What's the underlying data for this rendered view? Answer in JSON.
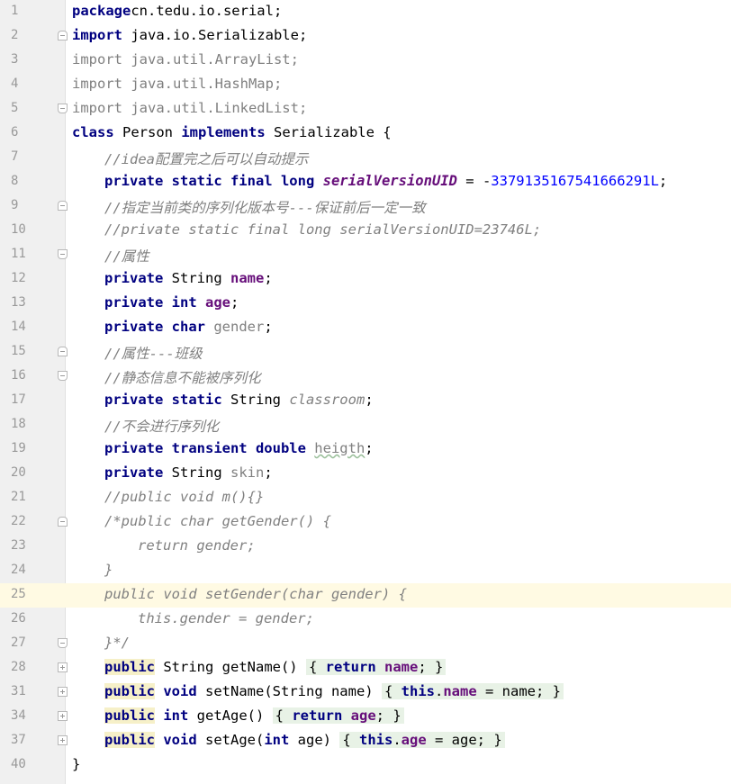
{
  "editor": {
    "current_line": "25",
    "lines": [
      {
        "n": "1",
        "fold": "",
        "indent": 0,
        "tokens": [
          [
            "kw",
            "package"
          ],
          [
            "",
            "cn.tedu.io.serial;"
          ]
        ]
      },
      {
        "n": "2",
        "fold": "start",
        "indent": 0,
        "tokens": [
          [
            "kw",
            "import"
          ],
          [
            "",
            " java.io.Serializable;"
          ]
        ]
      },
      {
        "n": "3",
        "fold": "",
        "indent": 0,
        "tokens": [
          [
            "kwg",
            "import"
          ],
          [
            "gray",
            " java.util.ArrayList;"
          ]
        ]
      },
      {
        "n": "4",
        "fold": "",
        "indent": 0,
        "tokens": [
          [
            "kwg",
            "import"
          ],
          [
            "gray",
            " java.util.HashMap;"
          ]
        ]
      },
      {
        "n": "5",
        "fold": "end",
        "indent": 0,
        "tokens": [
          [
            "kwg",
            "import"
          ],
          [
            "gray",
            " java.util.LinkedList;"
          ]
        ]
      },
      {
        "n": "6",
        "fold": "",
        "indent": 0,
        "tokens": [
          [
            "kw",
            "class"
          ],
          [
            "",
            " Person "
          ],
          [
            "kw",
            "implements"
          ],
          [
            "",
            " Serializable {"
          ]
        ]
      },
      {
        "n": "7",
        "fold": "",
        "indent": 1,
        "tokens": [
          [
            "cmt",
            "//idea配置完之后可以自动提示"
          ]
        ]
      },
      {
        "n": "8",
        "fold": "",
        "indent": 1,
        "tokens": [
          [
            "kw",
            "private static final long "
          ],
          [
            "const",
            "serialVersionUID"
          ],
          [
            "",
            " = -"
          ],
          [
            "num",
            "3379135167541666291L"
          ],
          [
            "",
            ";"
          ]
        ]
      },
      {
        "n": "9",
        "fold": "start",
        "indent": 1,
        "tokens": [
          [
            "cmt",
            "//指定当前类的序列化版本号---保证前后一定一致"
          ]
        ]
      },
      {
        "n": "10",
        "fold": "",
        "indent": 1,
        "tokens": [
          [
            "cmt",
            "//private static final long serialVersionUID=23746L;"
          ]
        ]
      },
      {
        "n": "11",
        "fold": "end",
        "indent": 1,
        "tokens": [
          [
            "cmt",
            "//属性"
          ]
        ]
      },
      {
        "n": "12",
        "fold": "",
        "indent": 1,
        "tokens": [
          [
            "kw",
            "private"
          ],
          [
            "",
            " String "
          ],
          [
            "fld",
            "name"
          ],
          [
            "",
            ";"
          ]
        ]
      },
      {
        "n": "13",
        "fold": "",
        "indent": 1,
        "tokens": [
          [
            "kw",
            "private int "
          ],
          [
            "fld",
            "age"
          ],
          [
            "",
            ";"
          ]
        ]
      },
      {
        "n": "14",
        "fold": "",
        "indent": 1,
        "tokens": [
          [
            "kw",
            "private char "
          ],
          [
            "fldg",
            "gender"
          ],
          [
            "",
            ";"
          ]
        ]
      },
      {
        "n": "15",
        "fold": "start",
        "indent": 1,
        "tokens": [
          [
            "cmt",
            "//属性---班级"
          ]
        ]
      },
      {
        "n": "16",
        "fold": "end",
        "indent": 1,
        "tokens": [
          [
            "cmt",
            "//静态信息不能被序列化"
          ]
        ]
      },
      {
        "n": "17",
        "fold": "",
        "indent": 1,
        "tokens": [
          [
            "kw",
            "private static"
          ],
          [
            "",
            " String "
          ],
          [
            "static-fld",
            "classroom"
          ],
          [
            "",
            ";"
          ]
        ]
      },
      {
        "n": "18",
        "fold": "",
        "indent": 1,
        "tokens": [
          [
            "cmt",
            "//不会进行序列化"
          ]
        ]
      },
      {
        "n": "19",
        "fold": "",
        "indent": 1,
        "tokens": [
          [
            "kw",
            "private transient double "
          ],
          [
            "fldg squiggle",
            "heigth"
          ],
          [
            "",
            ";"
          ]
        ]
      },
      {
        "n": "20",
        "fold": "",
        "indent": 1,
        "tokens": [
          [
            "kw",
            "private"
          ],
          [
            "",
            " String "
          ],
          [
            "fldg",
            "skin"
          ],
          [
            "",
            ";"
          ]
        ]
      },
      {
        "n": "21",
        "fold": "",
        "indent": 1,
        "tokens": [
          [
            "cmt",
            "//public void m(){}"
          ]
        ]
      },
      {
        "n": "22",
        "fold": "start",
        "indent": 1,
        "tokens": [
          [
            "cmt",
            "/*public char getGender() {"
          ]
        ]
      },
      {
        "n": "23",
        "fold": "",
        "indent": 2,
        "tokens": [
          [
            "cmt",
            "return gender;"
          ]
        ]
      },
      {
        "n": "24",
        "fold": "",
        "indent": 1,
        "tokens": [
          [
            "cmt",
            "}"
          ]
        ]
      },
      {
        "n": "25",
        "fold": "",
        "indent": 1,
        "tokens": [
          [
            "cmt",
            "public void setGender(char gender) {"
          ]
        ]
      },
      {
        "n": "26",
        "fold": "",
        "indent": 2,
        "tokens": [
          [
            "cmt",
            "this.gender = gender;"
          ]
        ]
      },
      {
        "n": "27",
        "fold": "end",
        "indent": 1,
        "tokens": [
          [
            "cmt",
            "}*/"
          ]
        ]
      },
      {
        "n": "28",
        "fold": "closed",
        "indent": 1,
        "tokens": [
          [
            "kw kw-hl",
            "public"
          ],
          [
            "",
            " String getName() "
          ],
          [
            "folded",
            "{ <kw>return</kw> <fld>name</fld>; }"
          ]
        ]
      },
      {
        "n": "31",
        "fold": "closed",
        "indent": 1,
        "tokens": [
          [
            "kw kw-hl",
            "public"
          ],
          [
            "kw",
            " void"
          ],
          [
            "",
            " setName(String name) "
          ],
          [
            "folded",
            "{ <kw>this</kw>.<fld>name</fld> = name; }"
          ]
        ]
      },
      {
        "n": "34",
        "fold": "closed",
        "indent": 1,
        "tokens": [
          [
            "kw kw-hl",
            "public"
          ],
          [
            "kw",
            " int"
          ],
          [
            "",
            " getAge() "
          ],
          [
            "folded",
            "{ <kw>return</kw> <fld>age</fld>; }"
          ]
        ]
      },
      {
        "n": "37",
        "fold": "closed",
        "indent": 1,
        "tokens": [
          [
            "kw kw-hl",
            "public"
          ],
          [
            "kw",
            " void"
          ],
          [
            "",
            " setAge("
          ],
          [
            "kw",
            "int"
          ],
          [
            "",
            " age) "
          ],
          [
            "folded",
            "{ <kw>this</kw>.<fld>age</fld> = age; }"
          ]
        ]
      },
      {
        "n": "40",
        "fold": "",
        "indent": 0,
        "tokens": [
          [
            "",
            "}"
          ]
        ]
      }
    ]
  }
}
